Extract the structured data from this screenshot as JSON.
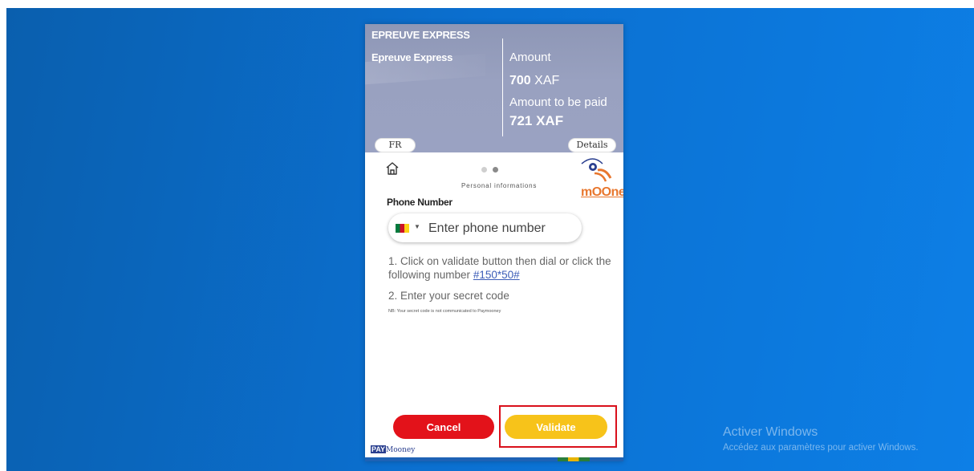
{
  "header": {
    "merchant": "EPREUVE EXPRESS",
    "service": "Epreuve Express",
    "amount_label": "Amount",
    "amount_value": "700",
    "amount_currency": "XAF",
    "topay_label": "Amount to be paid",
    "topay_value": "721 XAF",
    "lang_button": "FR",
    "details_button": "Details"
  },
  "steps": {
    "label": "Personal informations",
    "total": 2,
    "current": 2
  },
  "logo": {
    "text": "mOOney"
  },
  "form": {
    "phone_label": "Phone Number",
    "phone_placeholder": "Enter phone number",
    "country_flag": "cameroon-flag"
  },
  "instructions": {
    "line1": "1. Click on validate button then dial or click the following number ",
    "ussd_code": "#150*50#",
    "line2": "2. Enter your secret code",
    "note": "NB: Your secret code is not communicated to Paymooney"
  },
  "buttons": {
    "cancel": "Cancel",
    "validate": "Validate"
  },
  "footer": {
    "brand_box": "PAY",
    "brand_text": "Mooney"
  },
  "watermark": {
    "title": "Activer Windows",
    "subtitle": "Accédez aux paramètres pour activer Windows."
  },
  "colors": {
    "cancel": "#e3121a",
    "validate": "#f7c31a",
    "highlight": "#d9101b",
    "logo": "#e8772e",
    "link": "#3c5db8"
  }
}
